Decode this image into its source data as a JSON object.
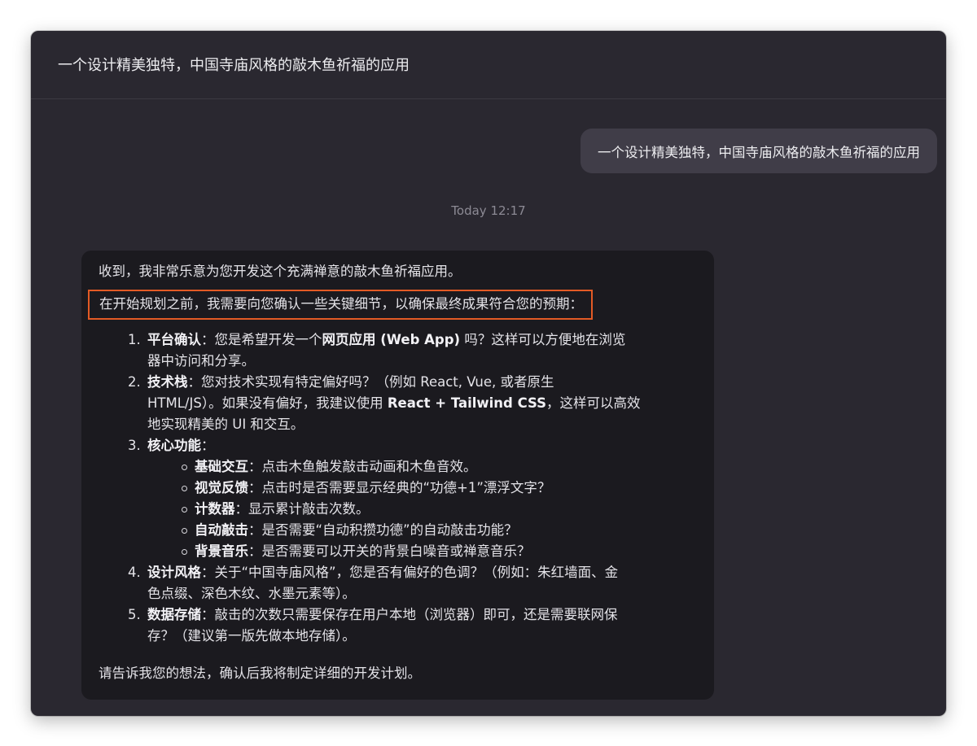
{
  "header": {
    "title": "一个设计精美独特，中国寺庙风格的敲木鱼祈福的应用"
  },
  "user_message": {
    "text": "一个设计精美独特，中国寺庙风格的敲木鱼祈福的应用"
  },
  "timestamp": "Today 12:17",
  "assistant_message": {
    "intro": "收到，我非常乐意为您开发这个充满禅意的敲木鱼祈福应用。",
    "highlighted": "在开始规划之前，我需要向您确认一些关键细节，以确保最终成果符合您的预期：",
    "items": [
      {
        "title": "平台确认",
        "line1_a": "：您是希望开发一个",
        "line1_b": "网页应用 (Web App)",
        "line1_c": " 吗？这样可以方便地在浏览",
        "line2": "器中访问和分享。"
      },
      {
        "title": "技术栈",
        "line1_a": "：您对技术实现有特定偏好吗？（例如 React, Vue, 或者原生",
        "line2_a": "HTML/JS）。如果没有偏好，我建议使用 ",
        "line2_b": "React + Tailwind CSS",
        "line2_c": "，这样可以高效",
        "line3": "地实现精美的 UI 和交互。"
      },
      {
        "title": "核心功能",
        "colon": "：",
        "subitems": [
          {
            "title": "基础交互",
            "text": "：点击木鱼触发敲击动画和木鱼音效。"
          },
          {
            "title": "视觉反馈",
            "text": "：点击时是否需要显示经典的“功德+1”漂浮文字？"
          },
          {
            "title": "计数器",
            "text": "：显示累计敲击次数。"
          },
          {
            "title": "自动敲击",
            "text": "：是否需要“自动积攒功德”的自动敲击功能？"
          },
          {
            "title": "背景音乐",
            "text": "：是否需要可以开关的背景白噪音或禅意音乐？"
          }
        ]
      },
      {
        "title": "设计风格",
        "line1_a": "：关于“中国寺庙风格”，您是否有偏好的色调？（例如：朱红墙面、金",
        "line2": "色点缀、深色木纹、水墨元素等）。"
      },
      {
        "title": "数据存储",
        "line1_a": "：敲击的次数只需要保存在用户本地（浏览器）即可，还是需要联网保",
        "line2": "存？（建议第一版先做本地存储）。"
      }
    ],
    "closing": "请告诉我您的想法，确认后我将制定详细的开发计划。"
  },
  "colors": {
    "window_bg": "#2a2830",
    "user_bubble_bg": "#403d48",
    "assistant_bubble_bg": "#1b1a1f",
    "highlight_border": "#e35a25",
    "timestamp_text": "#8c8a94"
  }
}
